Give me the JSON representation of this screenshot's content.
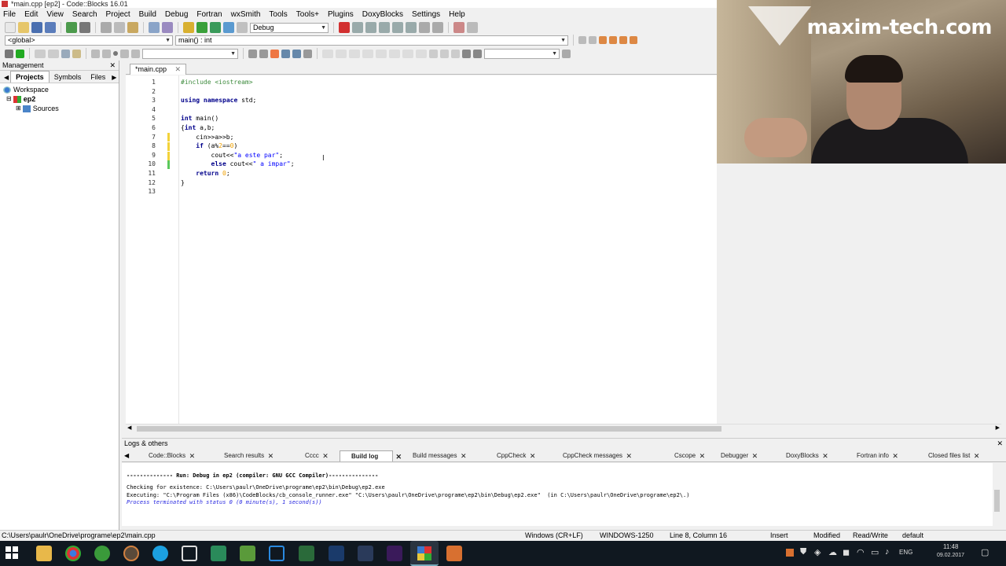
{
  "window": {
    "title": "*main.cpp [ep2] - Code::Blocks 16.01"
  },
  "menu": [
    "File",
    "Edit",
    "View",
    "Search",
    "Project",
    "Build",
    "Debug",
    "Fortran",
    "wxSmith",
    "Tools",
    "Tools+",
    "Plugins",
    "DoxyBlocks",
    "Settings",
    "Help"
  ],
  "toolbar": {
    "build_target": "Debug",
    "scope": "<global>",
    "function": "main() : int"
  },
  "management": {
    "title": "Management",
    "tabs": [
      "Projects",
      "Symbols",
      "Files"
    ],
    "tree": {
      "workspace": "Workspace",
      "project": "ep2",
      "folder": "Sources"
    }
  },
  "editor": {
    "tab": "*main.cpp",
    "lines": [
      {
        "n": "1",
        "code": "#include <iostream>"
      },
      {
        "n": "2",
        "code": ""
      },
      {
        "n": "3",
        "code": "using namespace std;"
      },
      {
        "n": "4",
        "code": ""
      },
      {
        "n": "5",
        "code": "int main()"
      },
      {
        "n": "6",
        "code": "{int a,b;"
      },
      {
        "n": "7",
        "code": "    cin>>a>>b;"
      },
      {
        "n": "8",
        "code": "    if (a%2==0)"
      },
      {
        "n": "9",
        "code": "        cout<<\"a este par\";"
      },
      {
        "n": "10",
        "code": "        else cout<<\" a impar\";"
      },
      {
        "n": "11",
        "code": "    return 0;"
      },
      {
        "n": "12",
        "code": "}"
      },
      {
        "n": "13",
        "code": ""
      }
    ]
  },
  "logs": {
    "title": "Logs & others",
    "tabs": [
      "Code::Blocks",
      "Search results",
      "Cccc",
      "Build log",
      "Build messages",
      "CppCheck",
      "CppCheck messages",
      "Cscope",
      "Debugger",
      "DoxyBlocks",
      "Fortran info",
      "Closed files list"
    ],
    "active_tab": "Build log",
    "lines": [
      "-------------- Run: Debug in ep2 (compiler: GNU GCC Compiler)---------------",
      "Checking for existence: C:\\Users\\paulr\\OneDrive\\programe\\ep2\\bin\\Debug\\ep2.exe",
      "Executing: \"C:\\Program Files (x86)\\CodeBlocks/cb_console_runner.exe\" \"C:\\Users\\paulr\\OneDrive\\programe\\ep2\\bin\\Debug\\ep2.exe\"  (in C:\\Users\\paulr\\OneDrive\\programe\\ep2\\.)",
      "Process terminated with status 0 (0 minute(s), 1 second(s))"
    ]
  },
  "status": {
    "path": "C:\\Users\\paulr\\OneDrive\\programe\\ep2\\main.cpp",
    "eol": "Windows (CR+LF)",
    "encoding": "WINDOWS-1250",
    "position": "Line 8, Column 16",
    "mode": "Insert",
    "modified": "Modified",
    "access": "Read/Write",
    "profile": "default"
  },
  "taskbar": {
    "lang": "ENG",
    "time": "11:48",
    "date": "09.02.2017"
  },
  "webcam": {
    "watermark": "maxim-tech.com"
  }
}
